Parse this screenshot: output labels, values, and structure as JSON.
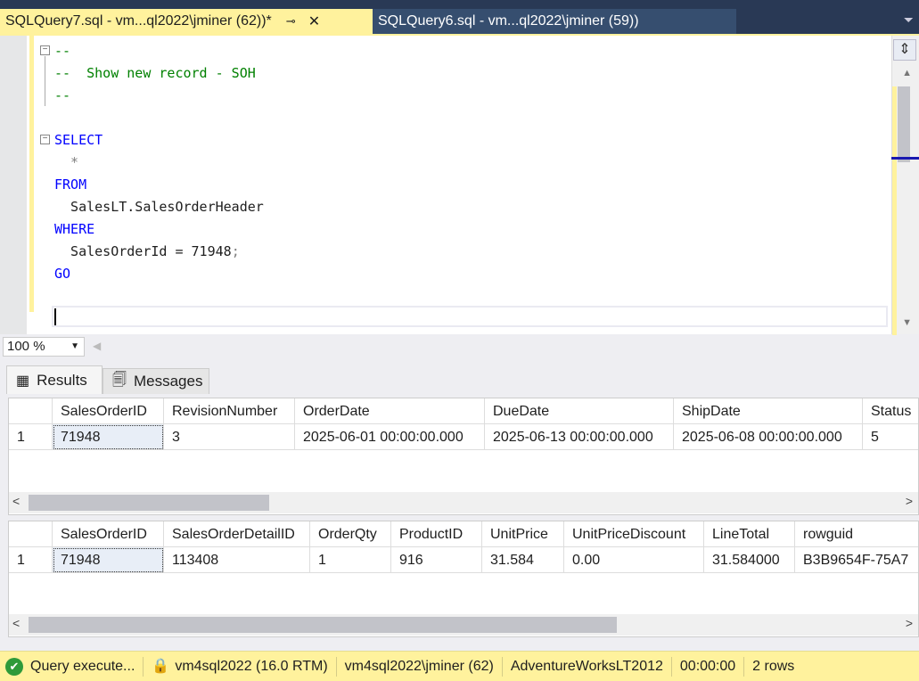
{
  "tabs": [
    {
      "label": "SQLQuery7.sql - vm...ql2022\\jminer (62))*",
      "active": true
    },
    {
      "label": "SQLQuery6.sql - vm...ql2022\\jminer (59))",
      "active": false
    }
  ],
  "editor": {
    "lines": {
      "l1": "--",
      "l2": "--  Show new record - SOH",
      "l3": "--",
      "l5": "SELECT",
      "l6": "  *",
      "l7": "FROM",
      "l8": "  SalesLT.SalesOrderHeader",
      "l9": "WHERE",
      "l10a": "  SalesOrderId = 71948",
      "l10b": ";",
      "l11": "GO"
    }
  },
  "zoom": "100 %",
  "result_tabs": {
    "results": "Results",
    "messages": "Messages"
  },
  "grid1": {
    "columns": [
      "SalesOrderID",
      "RevisionNumber",
      "OrderDate",
      "DueDate",
      "ShipDate",
      "Status"
    ],
    "rows": [
      [
        "1",
        "71948",
        "3",
        "2025-06-01 00:00:00.000",
        "2025-06-13 00:00:00.000",
        "2025-06-08 00:00:00.000",
        "5"
      ]
    ]
  },
  "grid2": {
    "columns": [
      "SalesOrderID",
      "SalesOrderDetailID",
      "OrderQty",
      "ProductID",
      "UnitPrice",
      "UnitPriceDiscount",
      "LineTotal",
      "rowguid"
    ],
    "rows": [
      [
        "1",
        "71948",
        "113408",
        "1",
        "916",
        "31.584",
        "0.00",
        "31.584000",
        "B3B9654F-75A7"
      ]
    ]
  },
  "status": {
    "query": "Query  execute...",
    "server": "vm4sql2022 (16.0 RTM)",
    "user": "vm4sql2022\\jminer (62)",
    "database": "AdventureWorksLT2012",
    "time": "00:00:00",
    "rows": "2 rows"
  }
}
